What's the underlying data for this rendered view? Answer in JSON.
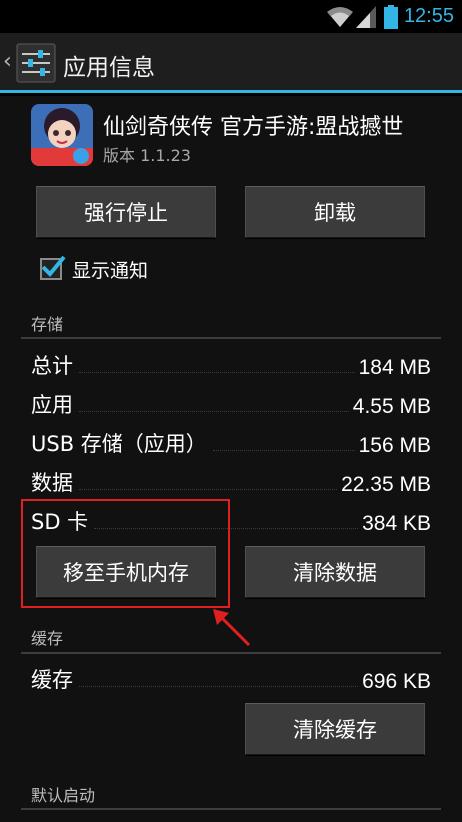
{
  "status_bar": {
    "time": "12:55",
    "icons": [
      "wifi-icon",
      "signal-icon",
      "battery-icon"
    ]
  },
  "action_bar": {
    "title": "应用信息",
    "icon": "settings-icon"
  },
  "app": {
    "name": "仙剑奇侠传 官方手游:盟战撼世",
    "version": "版本 1.1.23"
  },
  "buttons": {
    "force_stop": "强行停止",
    "uninstall": "卸载",
    "move_to_phone": "移至手机内存",
    "clear_data": "清除数据",
    "clear_cache": "清除缓存"
  },
  "notification": {
    "label": "显示通知",
    "checked": true
  },
  "storage": {
    "header": "存储",
    "rows": [
      {
        "label": "总计",
        "value": "184 MB"
      },
      {
        "label": "应用",
        "value": "4.55 MB"
      },
      {
        "label": "USB 存储（应用）",
        "value": "156 MB"
      },
      {
        "label": "数据",
        "value": "22.35 MB"
      },
      {
        "label": "SD 卡",
        "value": "384 KB"
      }
    ]
  },
  "cache": {
    "header": "缓存",
    "label": "缓存",
    "value": "696 KB"
  },
  "default_launch": {
    "header": "默认启动"
  },
  "colors": {
    "accent": "#33b5e5",
    "annotation": "#e02020"
  }
}
